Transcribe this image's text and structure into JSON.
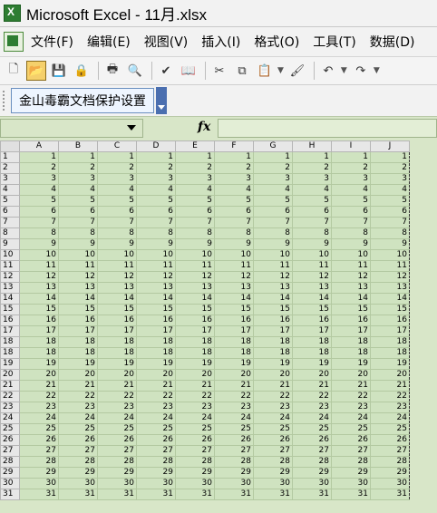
{
  "window": {
    "title": "Microsoft Excel - 11月.xlsx"
  },
  "menu": {
    "items": [
      "文件(F)",
      "编辑(E)",
      "视图(V)",
      "插入(I)",
      "格式(O)",
      "工具(T)",
      "数据(D)"
    ]
  },
  "toolbar": {
    "buttons": [
      {
        "name": "new-icon",
        "glyph": "🗋"
      },
      {
        "name": "open-folder-icon",
        "glyph": "📂",
        "active": true
      },
      {
        "name": "save-icon",
        "glyph": "💾"
      },
      {
        "name": "permission-icon",
        "glyph": "🔒"
      },
      {
        "name": "print-icon",
        "glyph": "🖶"
      },
      {
        "name": "print-preview-icon",
        "glyph": "🔍"
      },
      {
        "name": "spelling-icon",
        "glyph": "✔"
      },
      {
        "name": "research-icon",
        "glyph": "📖"
      },
      {
        "name": "cut-icon",
        "glyph": "✂"
      },
      {
        "name": "copy-icon",
        "glyph": "⧉"
      },
      {
        "name": "paste-icon",
        "glyph": "📋"
      },
      {
        "name": "format-painter-icon",
        "glyph": "🖌"
      },
      {
        "name": "undo-icon",
        "glyph": "↶"
      },
      {
        "name": "redo-icon",
        "glyph": "↷"
      }
    ]
  },
  "kingsoft": {
    "label": "金山毒霸文档保护设置"
  },
  "formula_bar": {
    "fx": "fx"
  },
  "grid": {
    "columns": [
      "A",
      "B",
      "C",
      "D",
      "E",
      "F",
      "G",
      "H",
      "I",
      "J"
    ],
    "rows": [
      "1",
      "2",
      "3",
      "4",
      "5",
      "6",
      "7",
      "8",
      "9",
      "10",
      "11",
      "12",
      "13",
      "14",
      "15",
      "16",
      "17",
      "18",
      "18",
      "19",
      "20",
      "21",
      "22",
      "23",
      "24",
      "25",
      "26",
      "27",
      "28",
      "29",
      "30",
      "31"
    ],
    "values": [
      1,
      2,
      3,
      4,
      5,
      6,
      7,
      8,
      9,
      10,
      11,
      12,
      13,
      14,
      15,
      16,
      17,
      18,
      18,
      19,
      20,
      21,
      22,
      23,
      24,
      25,
      26,
      27,
      28,
      29,
      30,
      31
    ]
  }
}
